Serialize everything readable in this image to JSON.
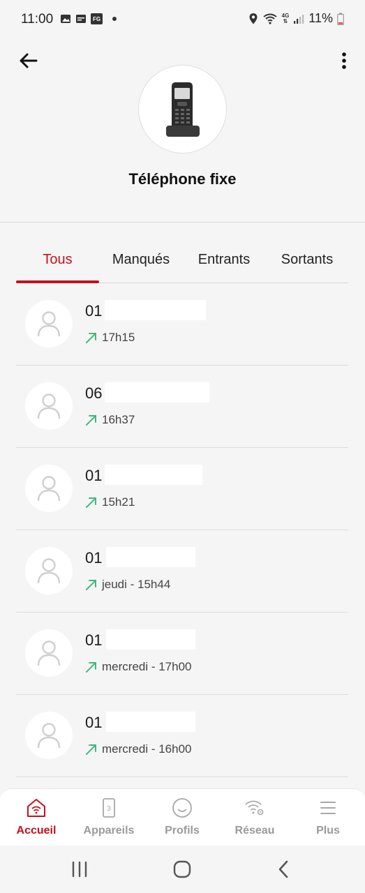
{
  "status_bar": {
    "time": "11:00",
    "battery": "11%",
    "network": "4G",
    "left_icons": [
      "image-icon",
      "calendar-icon",
      "fg-icon"
    ],
    "right_icons": [
      "location-icon",
      "wifi-icon",
      "signal-icon",
      "battery-icon"
    ]
  },
  "header": {
    "back_icon": "arrow-left-icon",
    "more_icon": "more-vertical-icon",
    "device_icon": "cordless-phone-icon",
    "title": "Téléphone fixe"
  },
  "tabs": [
    {
      "label": "Tous",
      "active": true
    },
    {
      "label": "Manqués",
      "active": false
    },
    {
      "label": "Entrants",
      "active": false
    },
    {
      "label": "Sortants",
      "active": false
    }
  ],
  "calls": [
    {
      "number": "01",
      "direction": "outgoing",
      "time": "17h15"
    },
    {
      "number": "06",
      "direction": "outgoing",
      "time": "16h37"
    },
    {
      "number": "01",
      "direction": "outgoing",
      "time": "15h21"
    },
    {
      "number": "01",
      "direction": "outgoing",
      "time": "jeudi - 15h44"
    },
    {
      "number": "01",
      "direction": "outgoing",
      "time": "mercredi - 17h00"
    },
    {
      "number": "01",
      "direction": "outgoing",
      "time": "mercredi - 16h00"
    }
  ],
  "bottom_nav": [
    {
      "label": "Accueil",
      "icon": "home-wifi-icon",
      "active": true
    },
    {
      "label": "Appareils",
      "icon": "devices-icon",
      "active": false
    },
    {
      "label": "Profils",
      "icon": "profile-icon",
      "active": false
    },
    {
      "label": "Réseau",
      "icon": "network-settings-icon",
      "active": false
    },
    {
      "label": "Plus",
      "icon": "menu-icon",
      "active": false
    }
  ],
  "colors": {
    "accent": "#c4111b",
    "outgoing_arrow": "#3dba7e",
    "background": "#f5f5f5",
    "inactive_nav": "#9a9a9a"
  }
}
